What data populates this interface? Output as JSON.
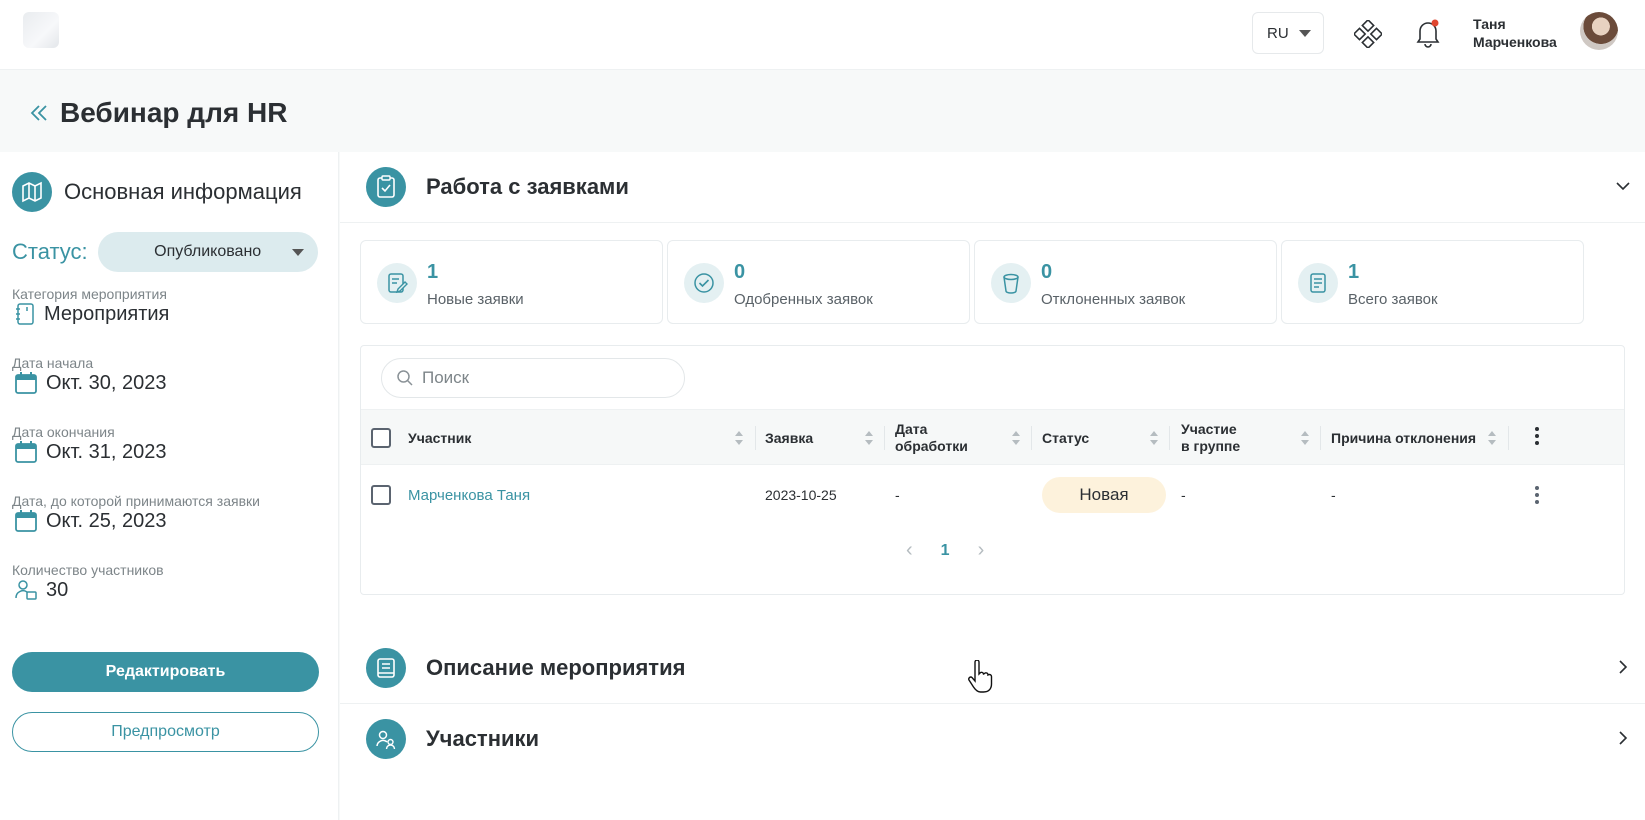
{
  "topbar": {
    "language": "RU",
    "user_name_line1": "Таня",
    "user_name_line2": "Марченкова",
    "icons": [
      "logo",
      "apps-icon",
      "bell-icon",
      "avatar"
    ],
    "notification_dot_color": "#e0462f"
  },
  "page": {
    "title": "Вебинар для HR"
  },
  "info_panel": {
    "heading": "Основная информация",
    "status_label": "Статус:",
    "status_value": "Опубликовано",
    "fields": [
      {
        "label": "Категория мероприятия",
        "value": "Мероприятия",
        "icon": "notebook-icon"
      },
      {
        "label": "Дата начала",
        "value": "Окт. 30, 2023",
        "icon": "calendar-icon"
      },
      {
        "label": "Дата окончания",
        "value": "Окт. 31, 2023",
        "icon": "calendar-icon"
      },
      {
        "label": "Дата, до которой принимаются заявки",
        "value": "Окт. 25, 2023",
        "icon": "calendar-icon"
      },
      {
        "label": "Количество участников",
        "value": "30",
        "icon": "participants-icon"
      }
    ],
    "edit_button": "Редактировать",
    "preview_button": "Предпросмотр"
  },
  "applications": {
    "title": "Работа с заявками",
    "stats": [
      {
        "value": "1",
        "label": "Новые заявки",
        "icon": "new-request-icon"
      },
      {
        "value": "0",
        "label": "Одобренных заявок",
        "icon": "approved-icon"
      },
      {
        "value": "0",
        "label": "Отклоненных заявок",
        "icon": "rejected-icon"
      },
      {
        "value": "1",
        "label": "Всего заявок",
        "icon": "document-icon"
      }
    ],
    "search_placeholder": "Поиск",
    "columns": {
      "participant": "Участник",
      "request": "Заявка",
      "processed_1": "Дата",
      "processed_2": "обработки",
      "status": "Статус",
      "group_1": "Участие",
      "group_2": "в группе",
      "reason": "Причина отклонения"
    },
    "rows": [
      {
        "participant": "Марченкова Таня",
        "request": "2023-10-25",
        "processed": "-",
        "status": "Новая",
        "group": "-",
        "reason": "-"
      }
    ],
    "pagination": {
      "prev": "‹",
      "current": "1",
      "next": "›"
    }
  },
  "sections": {
    "description": "Описание мероприятия",
    "participants": "Участники"
  },
  "colors": {
    "accent": "#3a93a3",
    "badge_new": "#fdf2dc",
    "status_select_bg": "#dcebee"
  }
}
